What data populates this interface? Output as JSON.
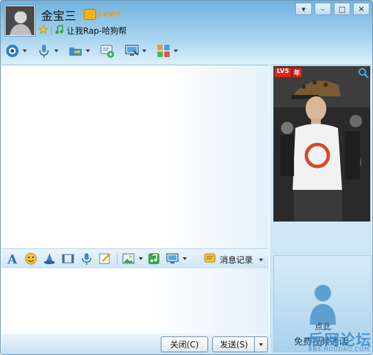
{
  "contact": {
    "name": "金宝三",
    "vip_label": "SVIP5",
    "signature": "让我Rap-哈狗帮"
  },
  "window_controls": {
    "menu": "▾",
    "minimize": "–",
    "maximize": "□",
    "close": "✕"
  },
  "toolbar": {
    "items": [
      "video-call",
      "voice-call",
      "send-file",
      "create-group",
      "remote-assist",
      "apps"
    ]
  },
  "photo": {
    "level_badge": "LV5",
    "year_badge": "年"
  },
  "input_toolbar": {
    "items": [
      "font",
      "emoji",
      "magic-expression",
      "screenshot-video",
      "voice-message",
      "doodle",
      "image",
      "music",
      "screen-share"
    ],
    "history_label": "消息记录"
  },
  "buttons": {
    "close_label": "关闭(C)",
    "send_label": "发送(S)"
  },
  "video_panel": {
    "line1": "点此",
    "line2": "免费视频通话"
  },
  "watermark": {
    "title": "后网论坛",
    "url": "BBS.HOUDAO.COM"
  },
  "colors": {
    "title_gradient_top": "#6fb3dd",
    "accent": "#3d8fd0"
  }
}
